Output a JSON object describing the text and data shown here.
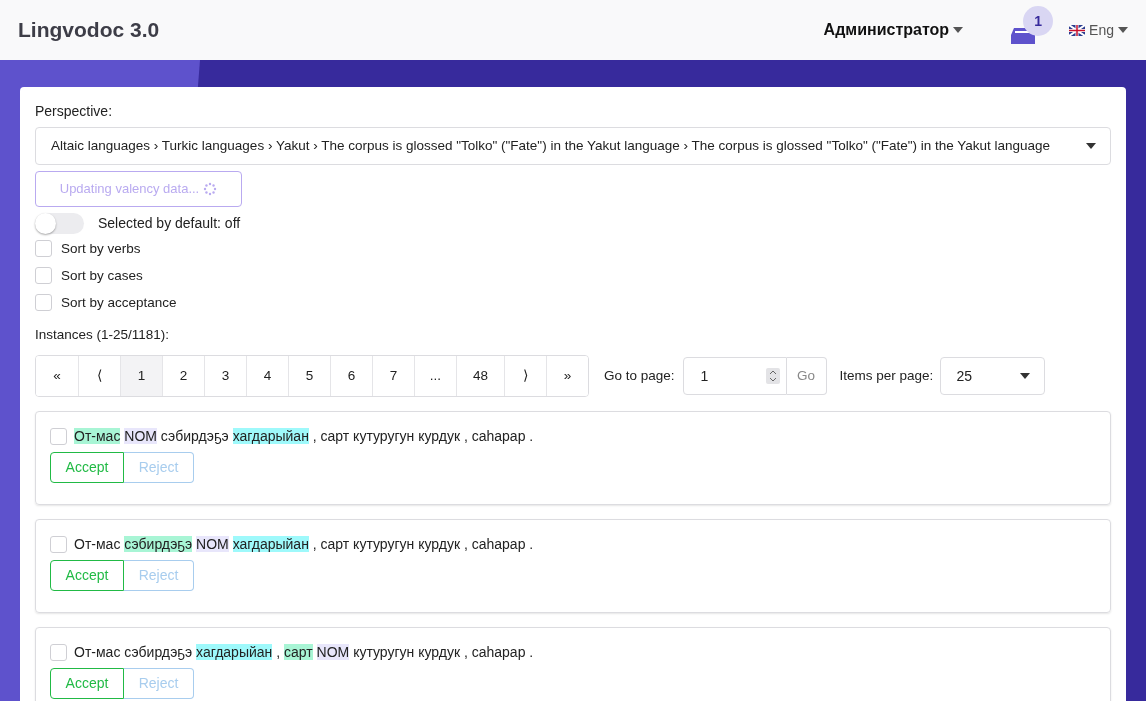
{
  "header": {
    "logo": "Lingvodoc 3.0",
    "user_menu": "Администратор",
    "notifications": {
      "count": "1"
    },
    "language": "Eng"
  },
  "perspective": {
    "label": "Perspective:",
    "value": "Altaic languages › Turkic languages › Yakut › The corpus is glossed \"Tolko\" (\"Fate\") in the Yakut language › The corpus is glossed \"Tolko\" (\"Fate\") in the Yakut language"
  },
  "update_button": {
    "label": "Updating valency data...",
    "disabled": true
  },
  "toggle": {
    "label": "Selected by default: off",
    "on": false
  },
  "options": [
    {
      "label": "Sort by verbs",
      "checked": false
    },
    {
      "label": "Sort by cases",
      "checked": false
    },
    {
      "label": "Sort by acceptance",
      "checked": false
    }
  ],
  "instances_label": "Instances (1-25/1181):",
  "pagination": [
    {
      "label": "«",
      "selected": false
    },
    {
      "label": "⟨",
      "selected": false
    },
    {
      "label": "1",
      "selected": true
    },
    {
      "label": "2",
      "selected": false
    },
    {
      "label": "3",
      "selected": false
    },
    {
      "label": "4",
      "selected": false
    },
    {
      "label": "5",
      "selected": false
    },
    {
      "label": "6",
      "selected": false
    },
    {
      "label": "7",
      "selected": false
    },
    {
      "label": "...",
      "selected": false
    },
    {
      "label": "48",
      "selected": false
    },
    {
      "label": "⟩",
      "selected": false
    },
    {
      "label": "»",
      "selected": false
    }
  ],
  "go_to_page": {
    "label": "Go to page:",
    "value": "1",
    "button": "Go"
  },
  "items_per_page": {
    "label": "Items per page:",
    "value": "25"
  },
  "instances": [
    {
      "checked": false,
      "tokens": [
        {
          "text": "От-мас",
          "kind": "case"
        },
        {
          "text": "NOM",
          "kind": "marker"
        },
        {
          "text": "сэбирдэҕэ",
          "kind": "plain"
        },
        {
          "text": "хагдарыйан",
          "kind": "verb"
        },
        {
          "text": ", сарт кутуругун курдук , саhарар .",
          "kind": "plain"
        }
      ],
      "accept": "Accept",
      "reject": "Reject"
    },
    {
      "checked": false,
      "tokens": [
        {
          "text": "От-мас",
          "kind": "plain"
        },
        {
          "text": "сэбирдэҕэ",
          "kind": "case"
        },
        {
          "text": "NOM",
          "kind": "marker"
        },
        {
          "text": "хагдарыйан",
          "kind": "verb"
        },
        {
          "text": ", сарт кутуругун курдук , саhарар .",
          "kind": "plain"
        }
      ],
      "accept": "Accept",
      "reject": "Reject"
    },
    {
      "checked": false,
      "tokens": [
        {
          "text": "От-мас сэбирдэҕэ",
          "kind": "plain"
        },
        {
          "text": "хагдарыйан",
          "kind": "verb"
        },
        {
          "text": ",",
          "kind": "plain"
        },
        {
          "text": "сарт",
          "kind": "case"
        },
        {
          "text": "NOM",
          "kind": "marker"
        },
        {
          "text": "кутуругун курдук , саhарар .",
          "kind": "plain"
        }
      ],
      "accept": "Accept",
      "reject": "Reject"
    }
  ]
}
